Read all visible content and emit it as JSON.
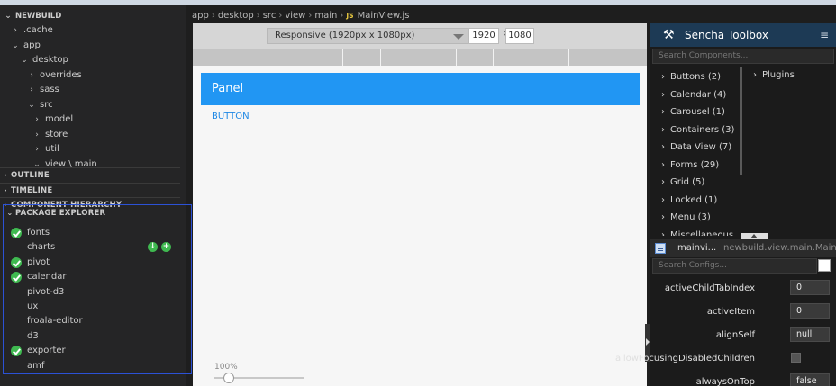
{
  "explorer": {
    "root": "NEWBUILD",
    "tree": [
      {
        "label": ".cache",
        "chev": "›"
      },
      {
        "label": "app",
        "chev": "⌄"
      },
      {
        "label": "desktop",
        "chev": "⌄"
      },
      {
        "label": "overrides",
        "chev": "›"
      },
      {
        "label": "sass",
        "chev": "›"
      },
      {
        "label": "src",
        "chev": "⌄"
      },
      {
        "label": "model",
        "chev": "›"
      },
      {
        "label": "store",
        "chev": "›"
      },
      {
        "label": "util",
        "chev": "›"
      },
      {
        "label": "view \\ main",
        "chev": "⌄"
      }
    ],
    "sections": {
      "outline": "OUTLINE",
      "timeline": "TIMELINE",
      "component_hierarchy": "COMPONENT HIERARCHY",
      "package_explorer": "PACKAGE EXPLORER"
    }
  },
  "packages": [
    {
      "name": "fonts",
      "installed": true
    },
    {
      "name": "charts",
      "installed": false
    },
    {
      "name": "pivot",
      "installed": true
    },
    {
      "name": "calendar",
      "installed": true
    },
    {
      "name": "pivot-d3",
      "installed": false
    },
    {
      "name": "ux",
      "installed": false
    },
    {
      "name": "froala-editor",
      "installed": false
    },
    {
      "name": "d3",
      "installed": false
    },
    {
      "name": "exporter",
      "installed": true
    },
    {
      "name": "amf",
      "installed": false
    }
  ],
  "breadcrumb": {
    "parts": [
      "app",
      "desktop",
      "src",
      "view",
      "main"
    ],
    "file_badge": "JS",
    "file": "MainView.js"
  },
  "preview": {
    "device": "Responsive (1920px x 1080px)",
    "width": "1920",
    "height": "1080",
    "times": "×",
    "panel_title": "Panel",
    "button_label": "BUTTON",
    "zoom": "100%",
    "zoom_fraction": 0.16
  },
  "toolbox": {
    "title": "Sencha Toolbox",
    "menu_icon": "≡",
    "tools_icon": "⚒",
    "search_placeholder": "Search Components...",
    "components": [
      "Buttons (2)",
      "Calendar (4)",
      "Carousel (1)",
      "Containers (3)",
      "Data View (7)",
      "Forms (29)",
      "Grid (5)",
      "Locked (1)",
      "Menu (3)",
      "Miscellaneous ..."
    ],
    "plugins": "Plugins",
    "config_name": "mainvi...",
    "config_class": "newbuild.view.main.MainV...",
    "config_search_placeholder": "Search Configs...",
    "configs": [
      {
        "label": "activeChildTabIndex",
        "value": "0",
        "type": "text"
      },
      {
        "label": "activeItem",
        "value": "0",
        "type": "text"
      },
      {
        "label": "alignSelf",
        "value": "null",
        "type": "text"
      },
      {
        "label": "allowFocusingDisabledChildren",
        "value": "",
        "type": "checkbox"
      },
      {
        "label": "alwaysOnTop",
        "value": "false",
        "type": "text"
      }
    ]
  },
  "colors": {
    "accent": "#2196f3",
    "selection_border": "#2c52d6",
    "installed": "#3fb950"
  }
}
